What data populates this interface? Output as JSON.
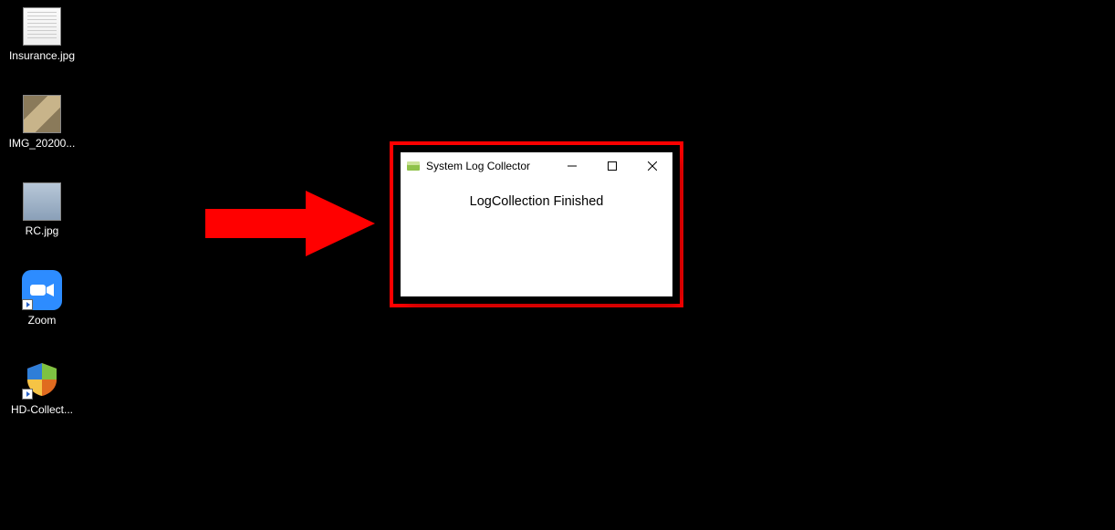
{
  "desktop": {
    "icons": [
      {
        "label": "Insurance.jpg",
        "kind": "doc"
      },
      {
        "label": "IMG_20200...",
        "kind": "photo"
      },
      {
        "label": "RC.jpg",
        "kind": "card"
      },
      {
        "label": "Zoom",
        "kind": "zoom"
      },
      {
        "label": "HD-Collect...",
        "kind": "shield"
      }
    ]
  },
  "window": {
    "title": "System Log Collector",
    "message": "LogCollection Finished"
  }
}
